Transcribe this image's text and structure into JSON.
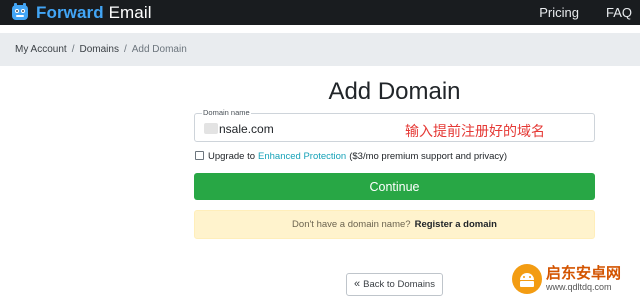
{
  "navbar": {
    "brand_forward": "Forward",
    "brand_email": "Email",
    "logo_icon": "forward-email-mascot-icon",
    "links": [
      {
        "label": "Pricing"
      },
      {
        "label": "FAQ"
      }
    ],
    "colors": {
      "background": "#191c1f",
      "brand_accent": "#42a5f5"
    }
  },
  "breadcrumb": {
    "items": [
      "My Account",
      "Domains"
    ],
    "separator": "/",
    "current": "Add Domain"
  },
  "main": {
    "title": "Add Domain",
    "domain_field": {
      "label": "Domain name",
      "value": "nsale.com",
      "value_partially_redacted": true
    },
    "annotation": "输入提前注册好的域名",
    "upgrade": {
      "checked": false,
      "prefix": "Upgrade to",
      "link": "Enhanced Protection",
      "suffix": "($3/mo premium support and privacy)"
    },
    "continue_label": "Continue",
    "notice": {
      "text": "Don't have a domain name?",
      "link": "Register a domain"
    },
    "back_label": "Back to Domains",
    "back_icon": "double-chevron-left-icon",
    "colors": {
      "continue": "#28a745",
      "notice_bg": "#fff3cd",
      "link": "#17a2b8",
      "annotation": "#e53935"
    }
  },
  "watermark": {
    "title": "启东安卓网",
    "url": "www.qdltdq.com",
    "logo_icon": "android-logo-icon"
  }
}
